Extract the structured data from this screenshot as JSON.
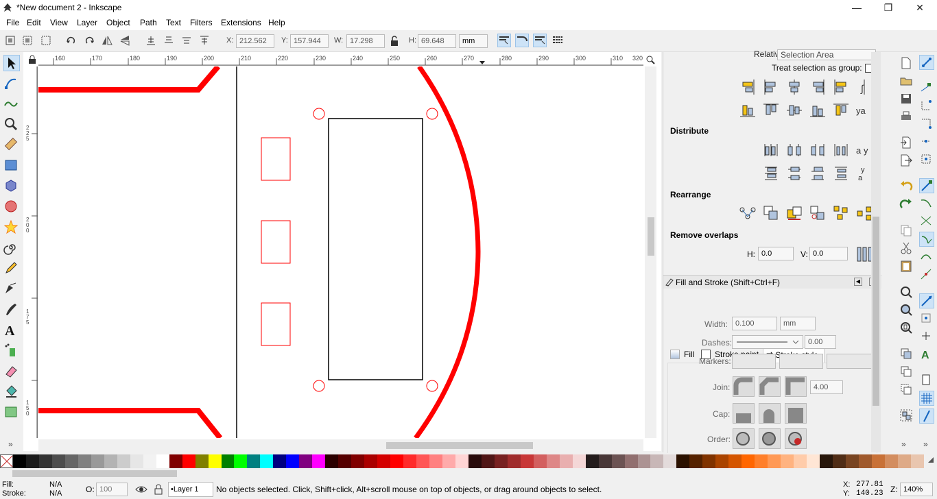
{
  "window": {
    "title": "*New document 2 - Inkscape",
    "minimize": "—",
    "maximize": "❐",
    "close": "✕"
  },
  "menu": [
    "File",
    "Edit",
    "View",
    "Layer",
    "Object",
    "Path",
    "Text",
    "Filters",
    "Extensions",
    "Help"
  ],
  "controls": {
    "x_label": "X:",
    "x": "212.562",
    "y_label": "Y:",
    "y": "157.944",
    "w_label": "W:",
    "w": "17.298",
    "h_label": "H:",
    "h": "69.648",
    "unit": "mm"
  },
  "ruler": {
    "h_ticks": [
      "160",
      "170",
      "180",
      "190",
      "200",
      "210",
      "220",
      "230",
      "240",
      "250",
      "260",
      "270",
      "280",
      "290",
      "300",
      "310",
      "320"
    ],
    "v_ticks": [
      "225",
      "200",
      "175",
      "150"
    ]
  },
  "align": {
    "relative_label": "Relative to:",
    "relative_value": "Selection Area",
    "group_label": "Treat selection as group:",
    "distribute": "Distribute",
    "rearrange": "Rearrange",
    "remove_overlaps": "Remove overlaps",
    "h_label": "H:",
    "h_value": "0.0",
    "v_label": "V:",
    "v_value": "0.0"
  },
  "fill_stroke": {
    "title": "Fill and Stroke (Shift+Ctrl+F)",
    "tabs": [
      "Fill",
      "Stroke paint",
      "Stroke style"
    ],
    "width_label": "Width:",
    "width": "0.100",
    "width_unit": "mm",
    "dashes_label": "Dashes:",
    "dash_offset": "0.00",
    "markers_label": "Markers:",
    "join_label": "Join:",
    "miter": "4.00",
    "cap_label": "Cap:",
    "order_label": "Order:"
  },
  "status": {
    "fill_label": "Fill:",
    "fill": "N/A",
    "stroke_label": "Stroke:",
    "stroke": "N/A",
    "opacity_label": "O:",
    "opacity": "100",
    "layer": "•Layer 1",
    "message": "No objects selected. Click, Shift+click, Alt+scroll mouse on top of objects, or drag around objects to select.",
    "x_label": "X:",
    "x": "277.81",
    "y_label": "Y:",
    "y": "140.23",
    "zoom_label": "Z:",
    "zoom": "140%"
  },
  "colors": {
    "red": "#ff0000",
    "accent": "#cde3f7"
  },
  "palette": [
    "#000000",
    "#1a1a1a",
    "#333333",
    "#4d4d4d",
    "#666666",
    "#808080",
    "#999999",
    "#b3b3b3",
    "#cccccc",
    "#e6e6e6",
    "#f2f2f2",
    "#ffffff",
    "#800000",
    "#ff0000",
    "#808000",
    "#ffff00",
    "#008000",
    "#00ff00",
    "#008080",
    "#00ffff",
    "#000080",
    "#0000ff",
    "#800080",
    "#ff00ff",
    "#2b0000",
    "#550000",
    "#800000",
    "#aa0000",
    "#d40000",
    "#ff0000",
    "#ff2a2a",
    "#ff5555",
    "#ff8080",
    "#ffaaaa",
    "#ffd5d5",
    "#280b0b",
    "#501616",
    "#782121",
    "#a02c2c",
    "#c83737",
    "#d35f5f",
    "#de8787",
    "#e9afaf",
    "#f4d7d7",
    "#241c1c",
    "#483737",
    "#6c5353",
    "#916f6f",
    "#ac9393",
    "#c8b7b7",
    "#e3dbdb",
    "#2b1100",
    "#552200",
    "#803300",
    "#aa4400",
    "#d45500",
    "#ff6600",
    "#ff7f2a",
    "#ff9955",
    "#ffb380",
    "#ffccaa",
    "#ffe6d5",
    "#28170b",
    "#502d16",
    "#784421",
    "#a05a2c",
    "#c87137",
    "#d38d5f",
    "#deaa87",
    "#e9c6af"
  ]
}
